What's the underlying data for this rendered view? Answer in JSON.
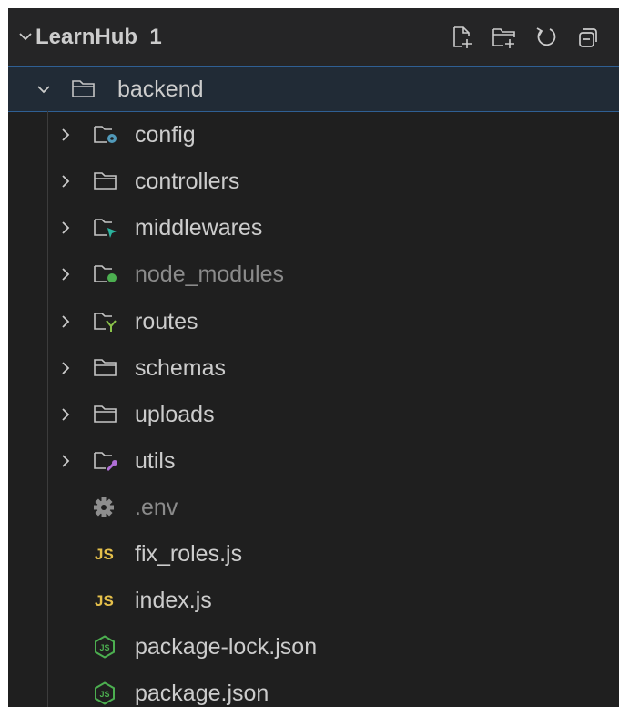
{
  "explorer": {
    "title": "LearnHub_1",
    "actions": [
      {
        "name": "new-file-icon"
      },
      {
        "name": "new-folder-icon"
      },
      {
        "name": "refresh-icon"
      },
      {
        "name": "collapse-all-icon"
      }
    ],
    "root_folder": "backend",
    "folders": [
      {
        "label": "config",
        "icon": "config-folder-icon",
        "accent": "#519aba"
      },
      {
        "label": "controllers",
        "icon": "folder-icon",
        "accent": "#c5c5c5"
      },
      {
        "label": "middlewares",
        "icon": "middleware-folder-icon",
        "accent": "#2bb39e"
      },
      {
        "label": "node_modules",
        "icon": "node-modules-folder-icon",
        "accent": "#4caf50"
      },
      {
        "label": "routes",
        "icon": "routes-folder-icon",
        "accent": "#8bc34a"
      },
      {
        "label": "schemas",
        "icon": "folder-icon",
        "accent": "#c5c5c5"
      },
      {
        "label": "uploads",
        "icon": "folder-icon",
        "accent": "#c5c5c5"
      },
      {
        "label": "utils",
        "icon": "utils-folder-icon",
        "accent": "#b06fd6"
      }
    ],
    "files": [
      {
        "label": ".env",
        "icon": "gear-icon",
        "badge": ""
      },
      {
        "label": "fix_roles.js",
        "icon": "javascript-icon",
        "badge": "JS"
      },
      {
        "label": "index.js",
        "icon": "javascript-icon",
        "badge": "JS"
      },
      {
        "label": "package-lock.json",
        "icon": "nodejs-icon",
        "badge": ""
      },
      {
        "label": "package.json",
        "icon": "nodejs-icon",
        "badge": ""
      }
    ],
    "colors": {
      "background": "#1f1f1f",
      "text": "#cccccc",
      "dim_text": "#8b8b8b",
      "selection_border": "#2f5f93",
      "js_badge": "#e5c04b",
      "node_green": "#4caf50"
    }
  }
}
